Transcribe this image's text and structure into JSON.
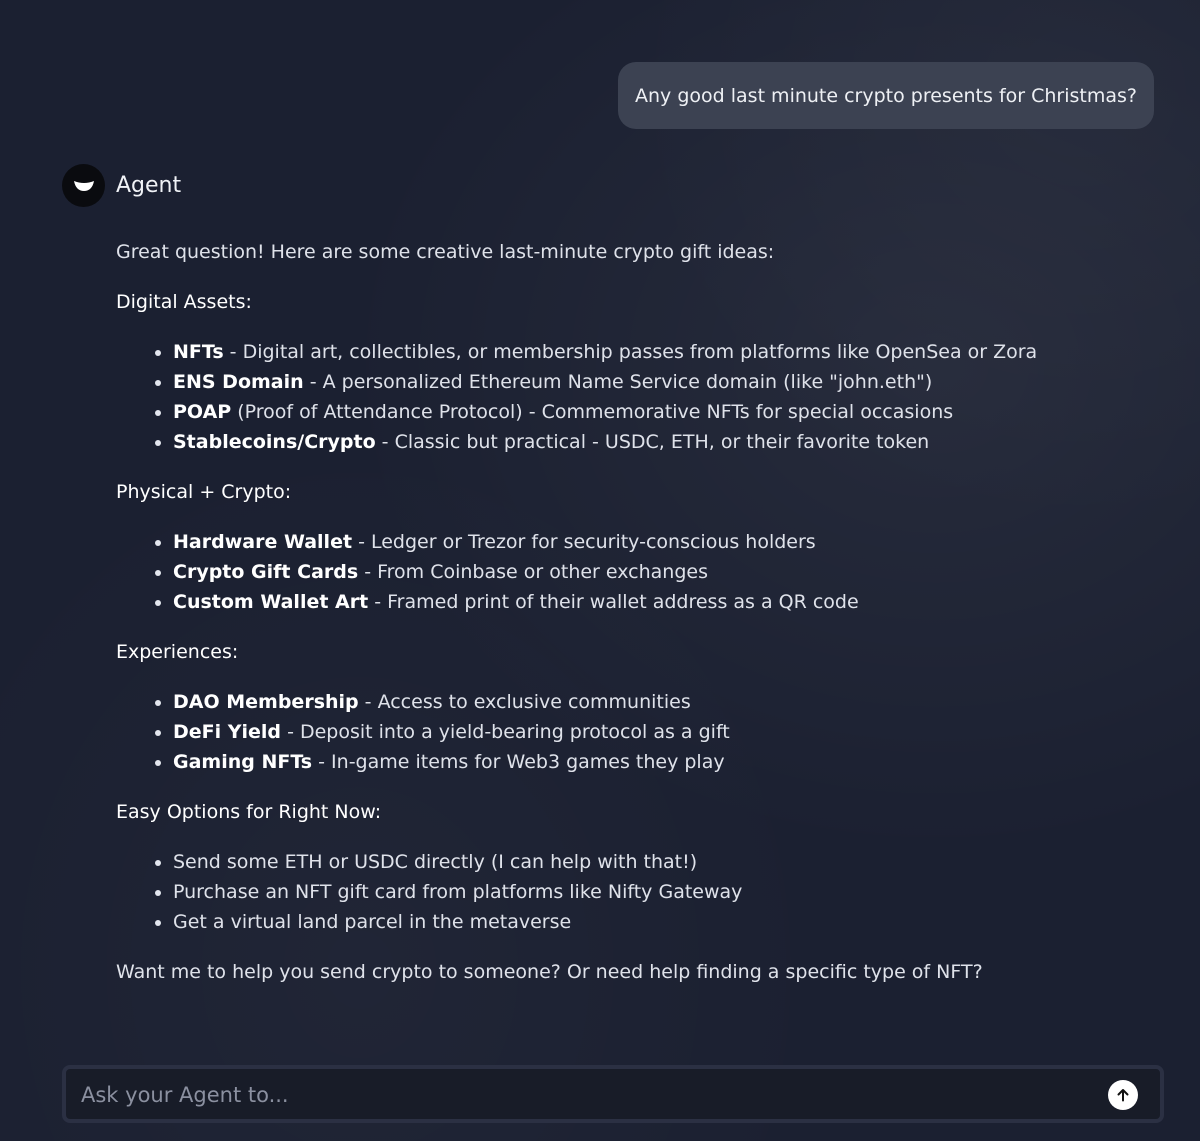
{
  "user_message": "Any good last minute crypto presents for Christmas?",
  "agent": {
    "name": "Agent",
    "avatar_icon": "eye-logo-icon"
  },
  "reply": {
    "intro": "Great question! Here are some creative last-minute crypto gift ideas:",
    "sections": [
      {
        "heading": "Digital Assets:",
        "items": [
          {
            "title": "NFTs",
            "text": " - Digital art, collectibles, or membership passes from platforms like OpenSea or Zora"
          },
          {
            "title": "ENS Domain",
            "text": " - A personalized Ethereum Name Service domain (like \"john.eth\")"
          },
          {
            "title": "POAP",
            "text": " (Proof of Attendance Protocol) - Commemorative NFTs for special occasions"
          },
          {
            "title": "Stablecoins/Crypto",
            "text": " - Classic but practical - USDC, ETH, or their favorite token"
          }
        ]
      },
      {
        "heading": "Physical + Crypto:",
        "items": [
          {
            "title": "Hardware Wallet",
            "text": " - Ledger or Trezor for security-conscious holders"
          },
          {
            "title": "Crypto Gift Cards",
            "text": " - From Coinbase or other exchanges"
          },
          {
            "title": "Custom Wallet Art",
            "text": " - Framed print of their wallet address as a QR code"
          }
        ]
      },
      {
        "heading": "Experiences:",
        "items": [
          {
            "title": "DAO Membership",
            "text": " - Access to exclusive communities"
          },
          {
            "title": "DeFi Yield",
            "text": " - Deposit into a yield-bearing protocol as a gift"
          },
          {
            "title": "Gaming NFTs",
            "text": " - In-game items for Web3 games they play"
          }
        ]
      },
      {
        "heading": "Easy Options for Right Now:",
        "items": [
          {
            "title": "",
            "text": "Send some ETH or USDC directly (I can help with that!)"
          },
          {
            "title": "",
            "text": "Purchase an NFT gift card from platforms like Nifty Gateway"
          },
          {
            "title": "",
            "text": "Get a virtual land parcel in the metaverse"
          }
        ]
      }
    ],
    "outro": "Want me to help you send crypto to someone? Or need help finding a specific type of NFT?"
  },
  "composer": {
    "placeholder": "Ask your Agent to...",
    "value": "",
    "send_icon": "arrow-up-icon"
  }
}
